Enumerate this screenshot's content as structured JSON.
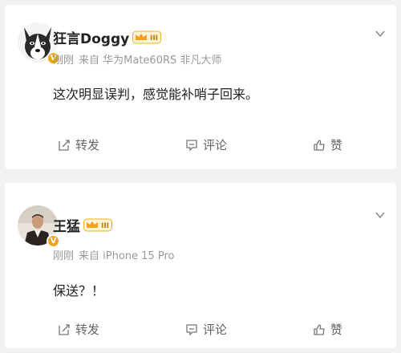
{
  "posts": [
    {
      "username": "狂言Doggy",
      "time": "刚刚",
      "source": "来自 华为Mate60RS 非凡大师",
      "content": "这次明显误判，感觉能补哨子回来。",
      "level": "III",
      "verified": "V",
      "actions": {
        "repost": "转发",
        "comment": "评论",
        "like": "赞"
      }
    },
    {
      "username": "王猛",
      "time": "刚刚",
      "source": "来自 iPhone 15 Pro",
      "content": "保送？！",
      "level": "III",
      "verified": "V",
      "actions": {
        "repost": "转发",
        "comment": "评论",
        "like": "赞"
      }
    }
  ],
  "colors": {
    "badge": "#f4a21b",
    "text_secondary": "#999999",
    "text_primary": "#222222"
  }
}
